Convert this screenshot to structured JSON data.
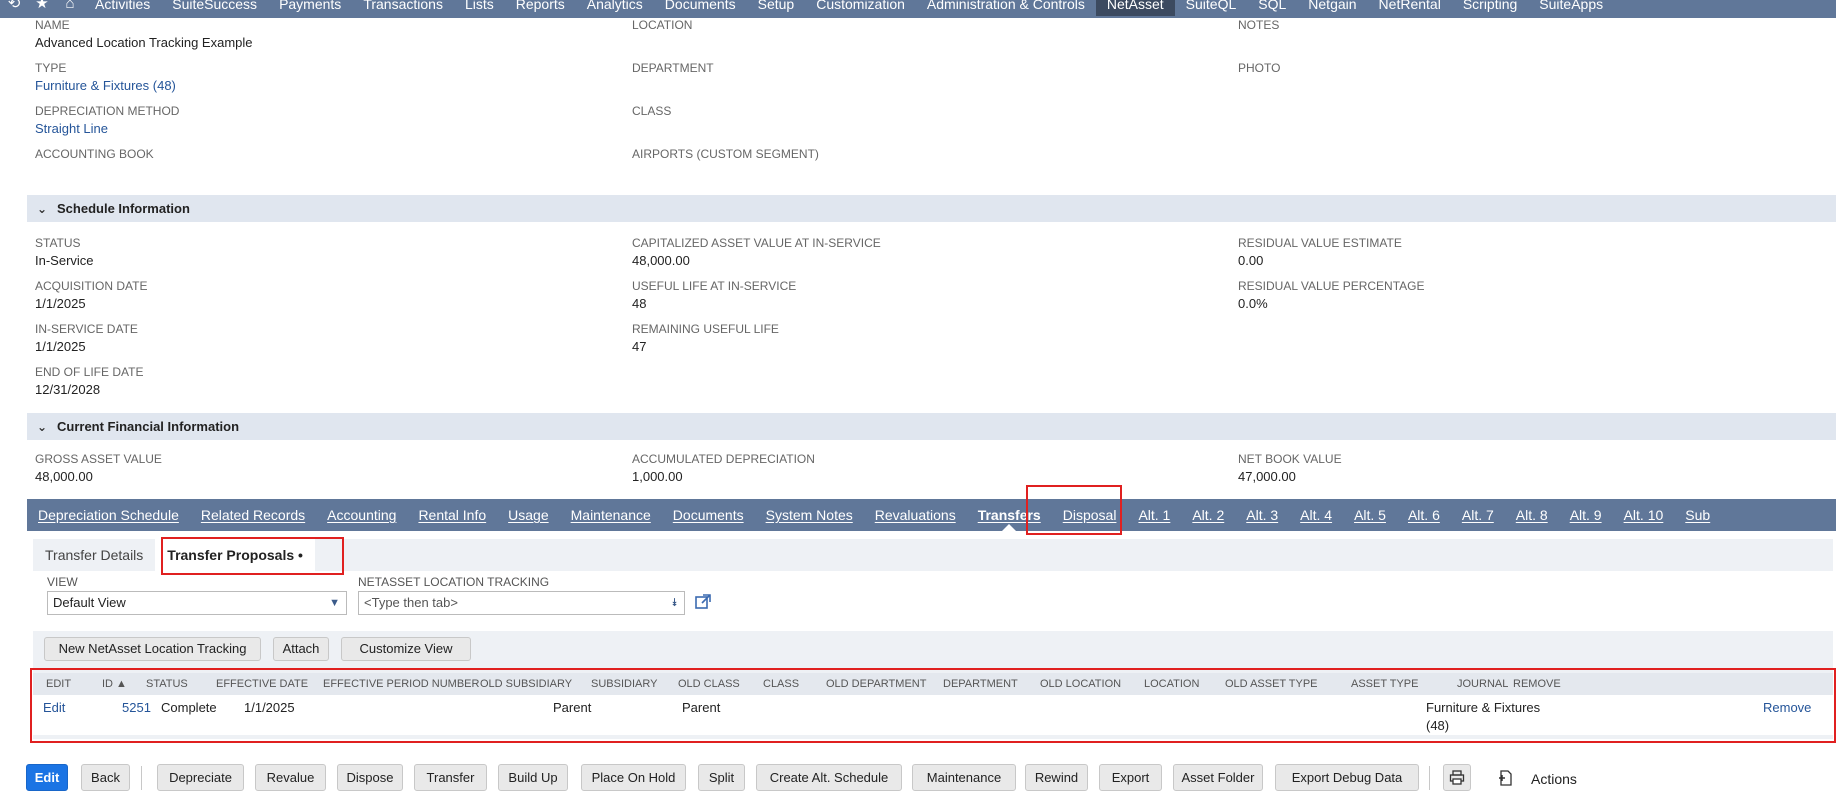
{
  "topnav": {
    "items": [
      "Activities",
      "SuiteSuccess",
      "Payments",
      "Transactions",
      "Lists",
      "Reports",
      "Analytics",
      "Documents",
      "Setup",
      "Customization",
      "Administration & Controls",
      "NetAsset",
      "SuiteQL",
      "SQL",
      "Netgain",
      "NetRental",
      "Scripting",
      "SuiteApps"
    ],
    "active": "NetAsset"
  },
  "primary": {
    "name_label": "NAME",
    "name_value": "Advanced Location Tracking Example",
    "location_label": "LOCATION",
    "notes_label": "NOTES",
    "type_label": "TYPE",
    "type_value": "Furniture & Fixtures (48)",
    "department_label": "DEPARTMENT",
    "photo_label": "PHOTO",
    "depmethod_label": "DEPRECIATION METHOD",
    "depmethod_value": "Straight Line",
    "class_label": "CLASS",
    "accbook_label": "ACCOUNTING BOOK",
    "airports_label": "AIRPORTS (CUSTOM SEGMENT)"
  },
  "schedule": {
    "title": "Schedule Information",
    "status_label": "STATUS",
    "status_value": "In-Service",
    "capval_label": "CAPITALIZED ASSET VALUE AT IN-SERVICE",
    "capval_value": "48,000.00",
    "resest_label": "RESIDUAL VALUE ESTIMATE",
    "resest_value": "0.00",
    "acqdate_label": "ACQUISITION DATE",
    "acqdate_value": "1/1/2025",
    "useful_label": "USEFUL LIFE AT IN-SERVICE",
    "useful_value": "48",
    "respct_label": "RESIDUAL VALUE PERCENTAGE",
    "respct_value": "0.0%",
    "insvc_label": "IN-SERVICE DATE",
    "insvc_value": "1/1/2025",
    "remain_label": "REMAINING USEFUL LIFE",
    "remain_value": "47",
    "eol_label": "END OF LIFE DATE",
    "eol_value": "12/31/2028"
  },
  "financial": {
    "title": "Current Financial Information",
    "gross_label": "GROSS ASSET VALUE",
    "gross_value": "48,000.00",
    "accdep_label": "ACCUMULATED DEPRECIATION",
    "accdep_value": "1,000.00",
    "nbv_label": "NET BOOK VALUE",
    "nbv_value": "47,000.00"
  },
  "tabs": [
    "Depreciation Schedule",
    "Related Records",
    "Accounting",
    "Rental Info",
    "Usage",
    "Maintenance",
    "Documents",
    "System Notes",
    "Revaluations",
    "Transfers",
    "Disposal",
    "Alt. 1",
    "Alt. 2",
    "Alt. 3",
    "Alt. 4",
    "Alt. 5",
    "Alt. 6",
    "Alt. 7",
    "Alt. 8",
    "Alt. 9",
    "Alt. 10",
    "Sub"
  ],
  "active_tab": "Transfers",
  "subtabs": {
    "details": "Transfer Details",
    "proposals": "Transfer Proposals •"
  },
  "filters": {
    "view_label": "VIEW",
    "view_value": "Default View",
    "tracking_label": "NETASSET LOCATION TRACKING",
    "tracking_placeholder": "<Type then tab>"
  },
  "list_buttons": {
    "new": "New NetAsset Location Tracking",
    "attach": "Attach",
    "customize": "Customize View"
  },
  "table": {
    "headers": [
      "EDIT",
      "ID ▲",
      "STATUS",
      "EFFECTIVE DATE",
      "EFFECTIVE PERIOD NUMBER",
      "OLD SUBSIDIARY",
      "SUBSIDIARY",
      "OLD CLASS",
      "CLASS",
      "OLD DEPARTMENT",
      "DEPARTMENT",
      "OLD LOCATION",
      "LOCATION",
      "OLD ASSET TYPE",
      "ASSET TYPE",
      "JOURNAL",
      "REMOVE"
    ],
    "row": {
      "edit": "Edit",
      "id": "5251",
      "status": "Complete",
      "effective_date": "1/1/2025",
      "old_subsidiary": "Parent",
      "subsidiary": "Parent",
      "old_asset_type_line1": "Furniture & Fixtures",
      "old_asset_type_line2": "(48)",
      "remove": "Remove"
    }
  },
  "bottom_buttons": {
    "edit": "Edit",
    "back": "Back",
    "depreciate": "Depreciate",
    "revalue": "Revalue",
    "dispose": "Dispose",
    "transfer": "Transfer",
    "buildup": "Build Up",
    "hold": "Place On Hold",
    "split": "Split",
    "altschedule": "Create Alt. Schedule",
    "maintenance": "Maintenance",
    "rewind": "Rewind",
    "export": "Export",
    "folder": "Asset Folder",
    "debug": "Export Debug Data",
    "actions": "Actions"
  }
}
